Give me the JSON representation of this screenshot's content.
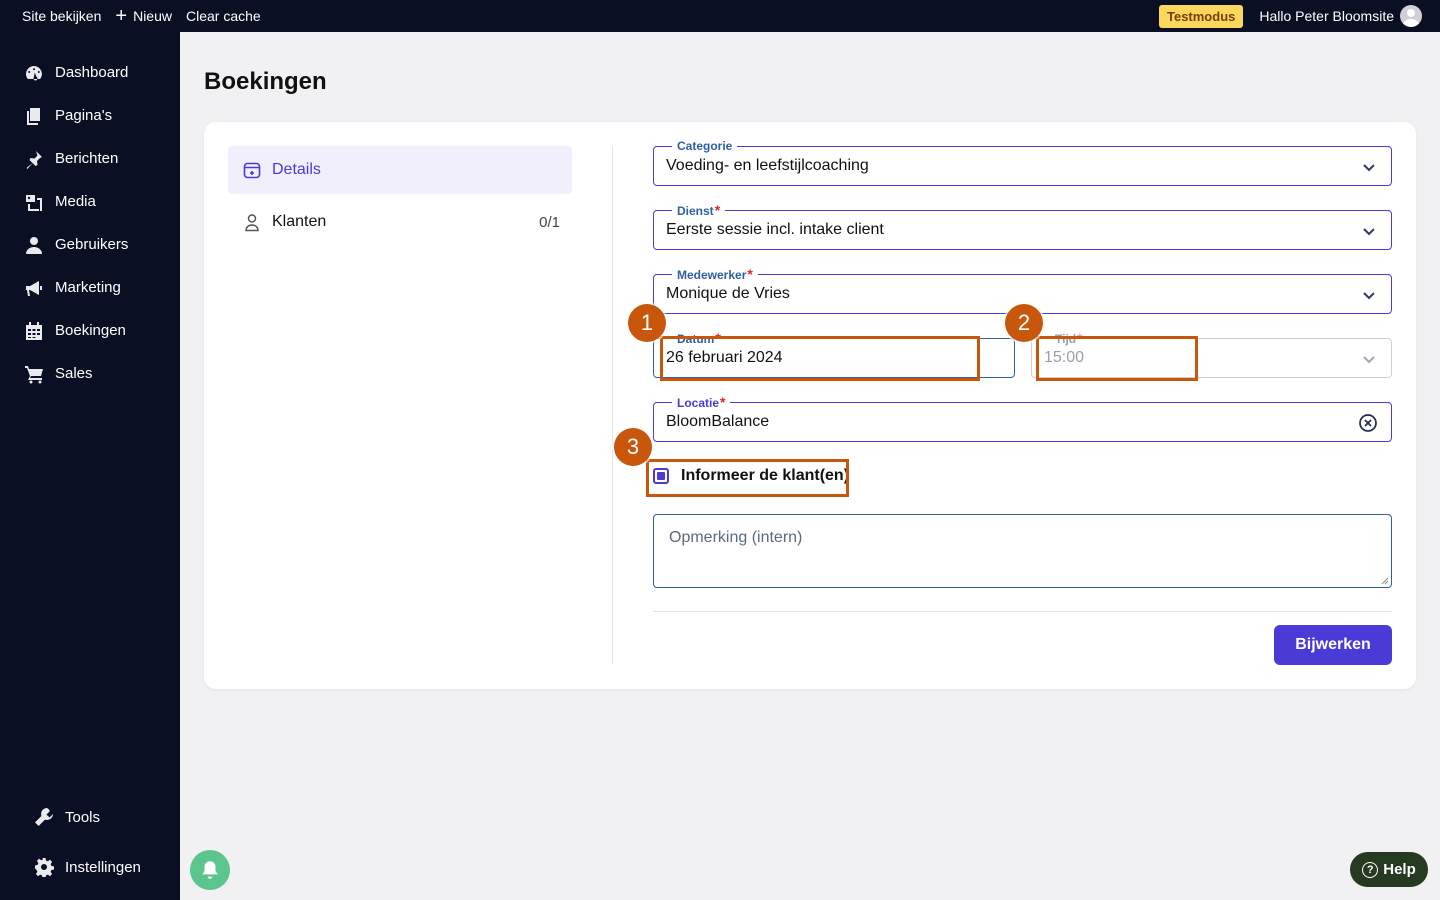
{
  "topbar": {
    "view_site": "Site bekijken",
    "new_plus": "+",
    "new_label": "Nieuw",
    "clear_cache": "Clear cache",
    "test_mode": "Testmodus",
    "greeting": "Hallo Peter Bloomsite"
  },
  "sidebar": {
    "items": [
      {
        "label": "Dashboard",
        "icon": "dashboard-icon"
      },
      {
        "label": "Pagina's",
        "icon": "pages-icon"
      },
      {
        "label": "Berichten",
        "icon": "pin-icon"
      },
      {
        "label": "Media",
        "icon": "media-icon"
      },
      {
        "label": "Gebruikers",
        "icon": "user-icon"
      },
      {
        "label": "Marketing",
        "icon": "megaphone-icon"
      },
      {
        "label": "Boekingen",
        "icon": "calendar-icon"
      },
      {
        "label": "Sales",
        "icon": "cart-icon"
      }
    ],
    "bottom": [
      {
        "label": "Tools",
        "icon": "wrench-icon"
      },
      {
        "label": "Instellingen",
        "icon": "gear-icon"
      }
    ]
  },
  "page": {
    "title": "Boekingen"
  },
  "tabs": [
    {
      "label": "Details",
      "active": true
    },
    {
      "label": "Klanten",
      "count": "0/1"
    }
  ],
  "form": {
    "categorie": {
      "label": "Categorie",
      "value": "Voeding- en leefstijlcoaching"
    },
    "dienst": {
      "label": "Dienst",
      "required": "*",
      "value": "Eerste sessie incl. intake client"
    },
    "medewerker": {
      "label": "Medewerker",
      "required": "*",
      "value": "Monique de Vries"
    },
    "datum": {
      "label": "Datum",
      "required": "*",
      "value": "26 februari 2024"
    },
    "tijd": {
      "label": "Tijd",
      "required": "*",
      "value": "15:00"
    },
    "locatie": {
      "label": "Locatie",
      "required": "*",
      "value": "BloomBalance"
    },
    "notify": {
      "label": "Informeer de klant(en)",
      "checked": true
    },
    "remark": {
      "placeholder": "Opmerking (intern)"
    },
    "submit": "Bijwerken"
  },
  "annotations": [
    "1",
    "2",
    "3"
  ],
  "help": {
    "label": "Help",
    "q": "?"
  },
  "colors": {
    "accent": "#4a3bd6",
    "sidebar": "#0b0f24",
    "highlight": "#c8570c",
    "badge": "#fbd85d"
  }
}
